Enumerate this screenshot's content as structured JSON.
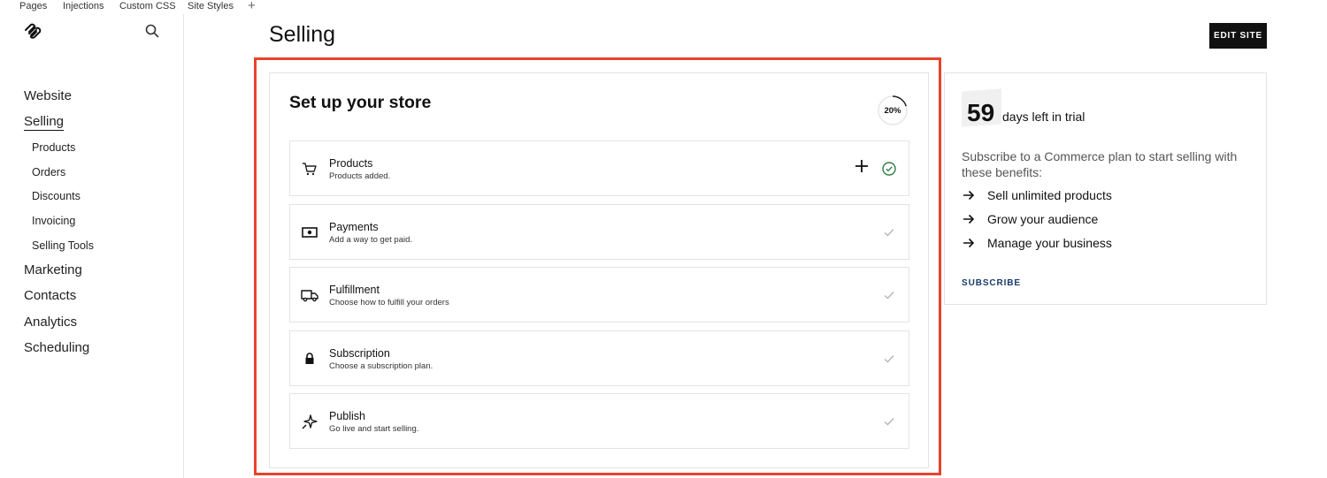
{
  "topbar": {
    "tabs": [
      "Pages",
      "Injections",
      "Custom CSS",
      "Site Styles"
    ],
    "add_label": "+"
  },
  "sidebar": {
    "main_items": [
      {
        "label": "Website"
      },
      {
        "label": "Selling",
        "active": true
      },
      {
        "label": "Marketing"
      },
      {
        "label": "Contacts"
      },
      {
        "label": "Analytics"
      },
      {
        "label": "Scheduling"
      }
    ],
    "sub_items": [
      "Products",
      "Orders",
      "Discounts",
      "Invoicing",
      "Selling Tools"
    ]
  },
  "header": {
    "title": "Selling",
    "edit_button": "EDIT SITE"
  },
  "store": {
    "title": "Set up your store",
    "progress_value": 0.2,
    "progress_label": "20%",
    "steps": [
      {
        "title": "Products",
        "desc": "Products added.",
        "icon": "cart-icon",
        "done": true
      },
      {
        "title": "Payments",
        "desc": "Add a way to get paid.",
        "icon": "cash-icon",
        "done": false
      },
      {
        "title": "Fulfillment",
        "desc": "Choose how to fulfill your orders",
        "icon": "truck-icon",
        "done": false
      },
      {
        "title": "Subscription",
        "desc": "Choose a subscription plan.",
        "icon": "lock-icon",
        "done": false
      },
      {
        "title": "Publish",
        "desc": "Go live and start selling.",
        "icon": "sparkle-icon",
        "done": false
      }
    ]
  },
  "trial": {
    "days": "59",
    "days_text": "days left in trial",
    "description": "Subscribe to a Commerce plan to start selling with these benefits:",
    "benefits": [
      "Sell unlimited products",
      "Grow your audience",
      "Manage your business"
    ],
    "subscribe_label": "SUBSCRIBE"
  },
  "colors": {
    "highlight": "#e8432c",
    "done_check": "#2e7d46",
    "pending_check": "#b5b5b5",
    "subscribe": "#1a3a6b"
  }
}
